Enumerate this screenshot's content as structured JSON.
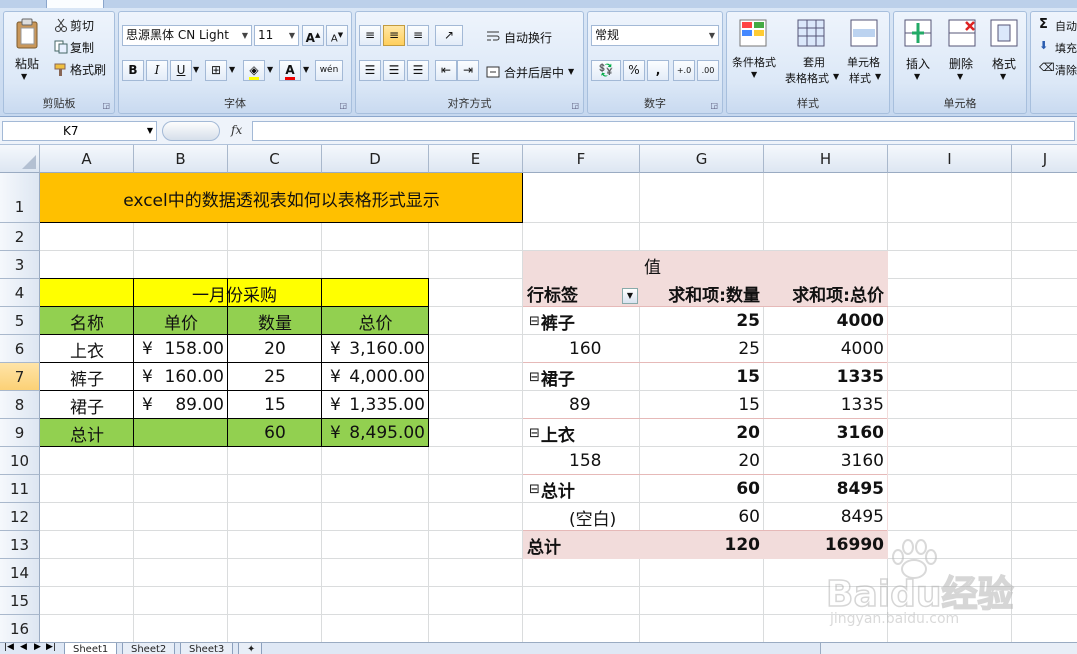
{
  "ribbon": {
    "clipboard": {
      "paste": "粘贴",
      "cut": "剪切",
      "copy": "复制",
      "format_painter": "格式刷",
      "group": "剪贴板"
    },
    "font": {
      "name": "思源黑体 CN Light",
      "size": "11",
      "grow": "A",
      "shrink": "A",
      "bold": "B",
      "italic": "I",
      "underline": "U",
      "phonetic": "wén",
      "group": "字体"
    },
    "alignment": {
      "wrap": "自动换行",
      "merge": "合并后居中",
      "group": "对齐方式"
    },
    "number": {
      "format": "常规",
      "percent": "%",
      "comma": ",",
      "inc_dec": "+.0",
      "dec_dec": ".00",
      "group": "数字"
    },
    "styles": {
      "conditional": "条件格式",
      "table_format_1": "套用",
      "table_format_2": "表格格式",
      "cell_styles_1": "单元格",
      "cell_styles_2": "样式",
      "group": "样式"
    },
    "cells": {
      "insert": "插入",
      "delete": "删除",
      "format": "格式",
      "group": "单元格"
    },
    "editing": {
      "autosum": "自动",
      "fill": "填充",
      "clear": "清除"
    }
  },
  "formula_bar": {
    "name_box": "K7",
    "fx": "fx"
  },
  "colors": {
    "title_fill": "#ffc000",
    "header_fill": "#ffff00",
    "green_fill": "#92d050",
    "pivot_fill": "#f2dcdb",
    "selected_header": "#fbd176"
  },
  "columns": [
    "A",
    "B",
    "C",
    "D",
    "E",
    "F",
    "G",
    "H",
    "I",
    "J"
  ],
  "rows": [
    "1",
    "2",
    "3",
    "4",
    "5",
    "6",
    "7",
    "8",
    "9",
    "10",
    "11",
    "12",
    "13",
    "14",
    "15",
    "16"
  ],
  "selected": {
    "col": "K",
    "row": "7"
  },
  "sheet": {
    "title": "excel中的数据透视表如何以表格形式显示",
    "table_title": "一月份采购",
    "headers": [
      "名称",
      "单价",
      "数量",
      "总价"
    ],
    "data": [
      {
        "name": "上衣",
        "cur": "¥",
        "price": "158.00",
        "qty": "20",
        "cur2": "¥",
        "total": "3,160.00"
      },
      {
        "name": "裤子",
        "cur": "¥",
        "price": "160.00",
        "qty": "25",
        "cur2": "¥",
        "total": "4,000.00"
      },
      {
        "name": "裙子",
        "cur": "¥",
        "price": "89.00",
        "qty": "15",
        "cur2": "¥",
        "total": "1,335.00"
      }
    ],
    "total": {
      "label": "总计",
      "qty": "60",
      "cur": "¥",
      "total": "8,495.00"
    }
  },
  "pivot": {
    "values_label": "值",
    "row_label": "行标签",
    "col1": "求和项:数量",
    "col2": "求和项:总价",
    "toggle": "⊟",
    "rows": [
      {
        "label": "裤子",
        "v1": "25",
        "v2": "4000",
        "bold": true,
        "toggle": true
      },
      {
        "label": "160",
        "v1": "25",
        "v2": "4000",
        "bold": false,
        "toggle": false
      },
      {
        "label": "裙子",
        "v1": "15",
        "v2": "1335",
        "bold": true,
        "toggle": true
      },
      {
        "label": "89",
        "v1": "15",
        "v2": "1335",
        "bold": false,
        "toggle": false
      },
      {
        "label": "上衣",
        "v1": "20",
        "v2": "3160",
        "bold": true,
        "toggle": true
      },
      {
        "label": "158",
        "v1": "20",
        "v2": "3160",
        "bold": false,
        "toggle": false
      },
      {
        "label": "总计",
        "v1": "60",
        "v2": "8495",
        "bold": true,
        "toggle": true
      },
      {
        "label": "(空白)",
        "v1": "60",
        "v2": "8495",
        "bold": false,
        "toggle": false
      }
    ],
    "grand_total": {
      "label": "总计",
      "v1": "120",
      "v2": "16990"
    }
  },
  "tabs": [
    "Sheet1",
    "Sheet2",
    "Sheet3"
  ],
  "watermark": {
    "brand": "Baidu经验",
    "url": "jingyan.baidu.com"
  }
}
